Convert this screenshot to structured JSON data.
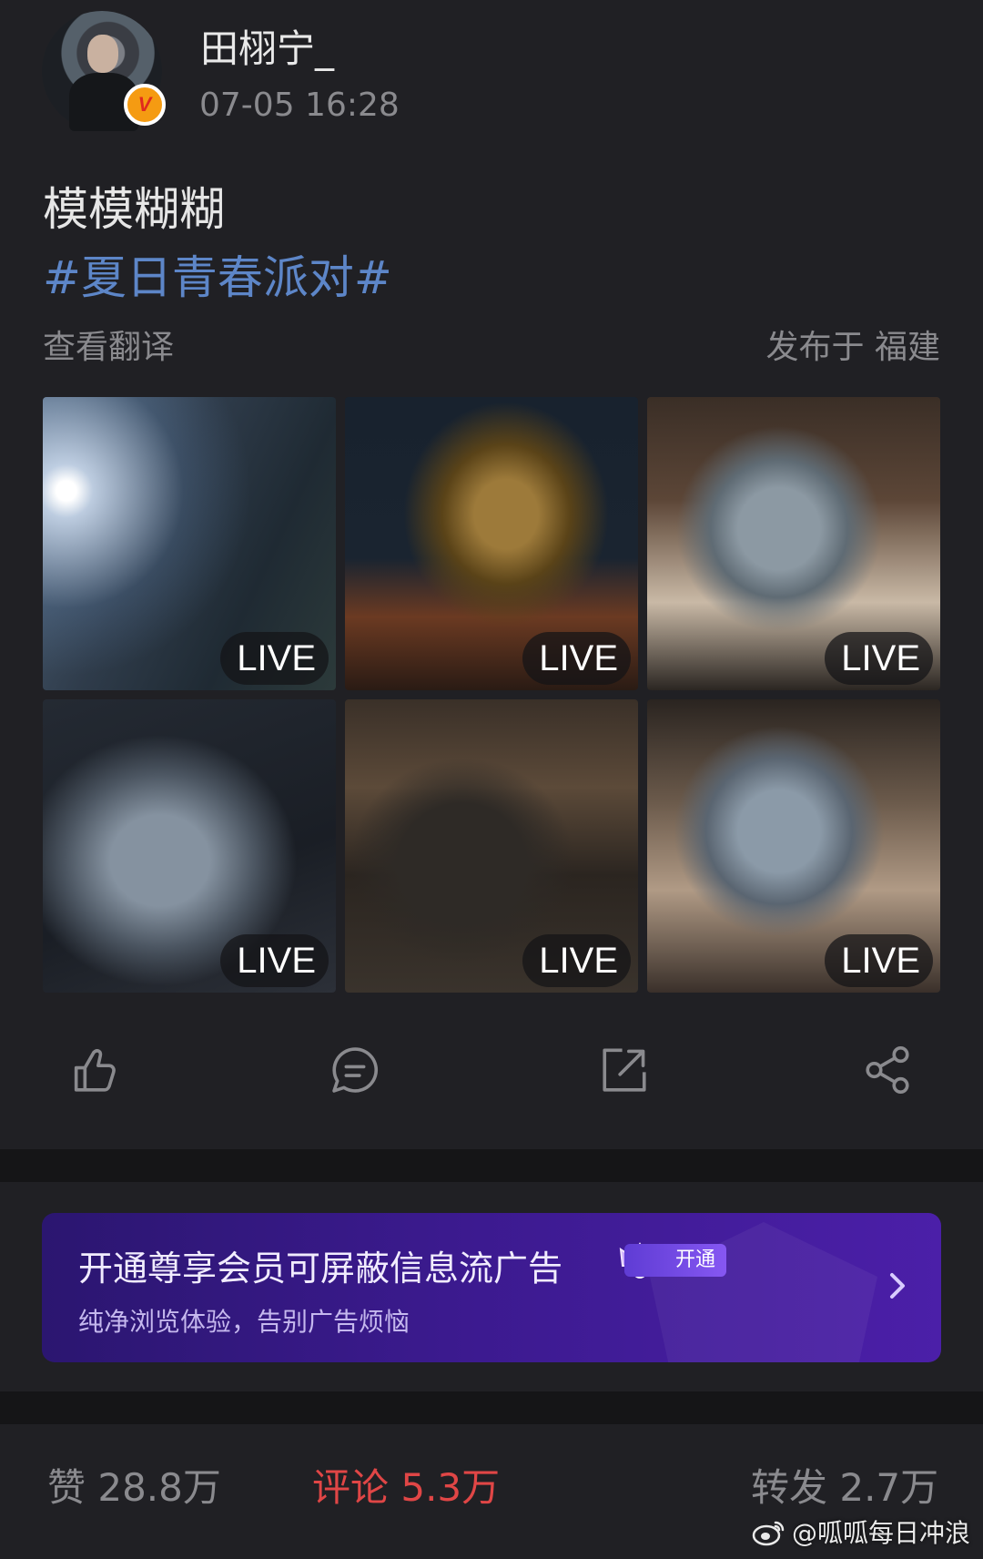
{
  "post": {
    "username": "田栩宁_",
    "timestamp": "07-05 16:28",
    "text": "模模糊糊",
    "hashtag": "#夏日青春派对#",
    "translate_label": "查看翻译",
    "location": "发布于 福建",
    "verified_badge": "V"
  },
  "photos": [
    {
      "badge": "LIVE"
    },
    {
      "badge": "LIVE"
    },
    {
      "badge": "LIVE"
    },
    {
      "badge": "LIVE"
    },
    {
      "badge": "LIVE"
    },
    {
      "badge": "LIVE"
    }
  ],
  "actions": {
    "like_icon": "thumbs-up-icon",
    "comment_icon": "comment-icon",
    "repost_icon": "repost-icon",
    "share_icon": "share-icon"
  },
  "ad": {
    "title": "开通尊享会员可屏蔽信息流广告",
    "subtitle": "纯净浏览体验，告别广告烦恼",
    "badge": "开通"
  },
  "stats": {
    "likes": "赞 28.8万",
    "comments": "评论 5.3万",
    "reposts": "转发 2.7万"
  },
  "watermark": "@呱呱每日冲浪",
  "colors": {
    "background": "#202024",
    "link": "#5d86c8",
    "comment_accent": "#e04646",
    "ad_purple": "#3b1a8e"
  }
}
